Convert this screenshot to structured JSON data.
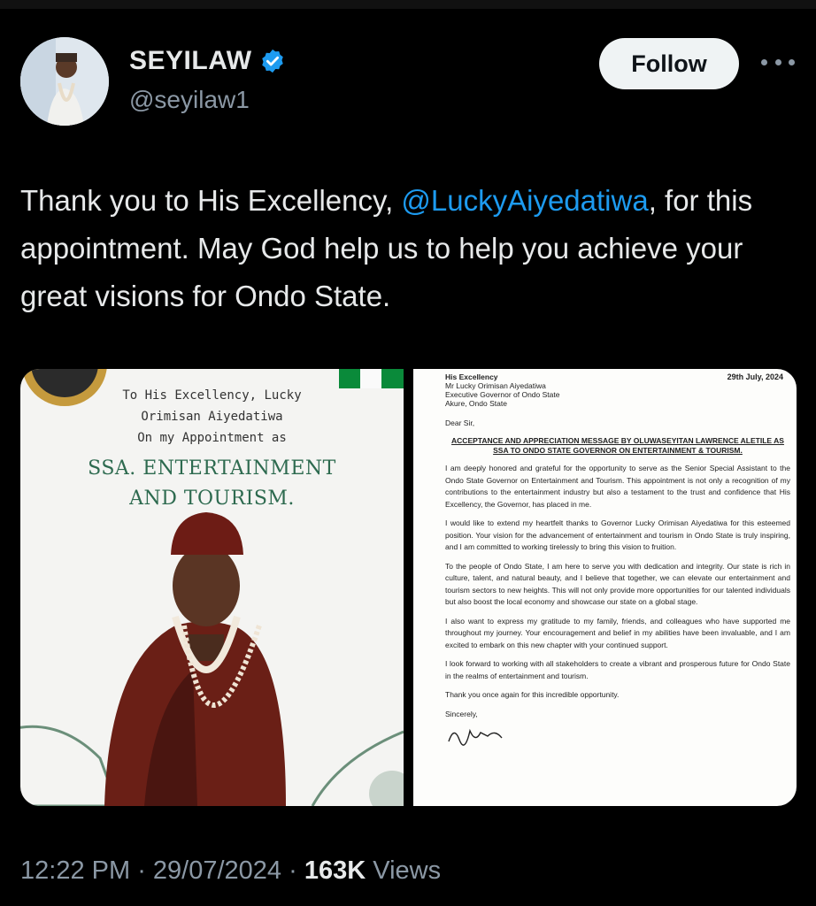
{
  "user": {
    "display_name": "SEYILAW",
    "handle": "@seyilaw1",
    "verified": true
  },
  "follow_label": "Follow",
  "tweet": {
    "text_part1": "Thank you to His Excellency, ",
    "mention": "@LuckyAiyedatiwa",
    "text_part2": ", for this appointment. May God help us to help you achieve your great visions for Ondo State."
  },
  "poster": {
    "lines": [
      "To His Excellency, Lucky",
      "Orimisan Aiyedatiwa",
      "On my Appointment as"
    ],
    "title_lines": [
      "SSA. ENTERTAINMENT",
      "AND TOURISM."
    ]
  },
  "letter": {
    "address": [
      "His Excellency",
      "Mr Lucky Orimisan Aiyedatiwa",
      "Executive Governor of Ondo State",
      "Akure, Ondo State"
    ],
    "date": "29th July, 2024",
    "salutation": "Dear Sir,",
    "subject": [
      "ACCEPTANCE AND APPRECIATION MESSAGE BY OLUWASEYITAN LAWRENCE ALETILE AS",
      "SSA TO ONDO STATE GOVERNOR ON ENTERTAINMENT & TOURISM."
    ],
    "paragraphs": [
      "I am deeply honored and grateful for the opportunity to serve as the Senior Special Assistant to the Ondo State Governor on Entertainment and Tourism. This appointment is not only a recognition of my contributions to the entertainment industry but also a testament to the trust and confidence that His Excellency, the Governor, has placed in me.",
      "I would like to extend my heartfelt thanks to Governor Lucky Orimisan Aiyedatiwa for this esteemed position. Your vision for the advancement of entertainment and tourism in Ondo State is truly inspiring, and I am committed to working tirelessly to bring this vision to fruition.",
      "To the people of Ondo State, I am here to serve you with dedication and integrity. Our state is rich in culture, talent, and natural beauty, and I believe that together, we can elevate our entertainment and tourism sectors to new heights. This will not only provide more opportunities for our talented individuals but also boost the local economy and showcase our state on a global stage.",
      "I also want to express my gratitude to my family, friends, and colleagues who have supported me throughout my journey. Your encouragement and belief in my abilities have been invaluable, and I am excited to embark on this new chapter with your continued support.",
      "I look forward to working with all stakeholders to create a vibrant and prosperous future for Ondo State in the realms of entertainment and tourism.",
      "Thank you once again for this incredible opportunity.",
      "Sincerely,"
    ]
  },
  "meta": {
    "time": "12:22 PM",
    "date": "29/07/2024",
    "views_count": "163K",
    "views_label": "Views"
  },
  "colors": {
    "background": "#000000",
    "mention": "#1d9bf0",
    "secondary_text": "#8b98a5",
    "verified": "#1d9bf0"
  }
}
